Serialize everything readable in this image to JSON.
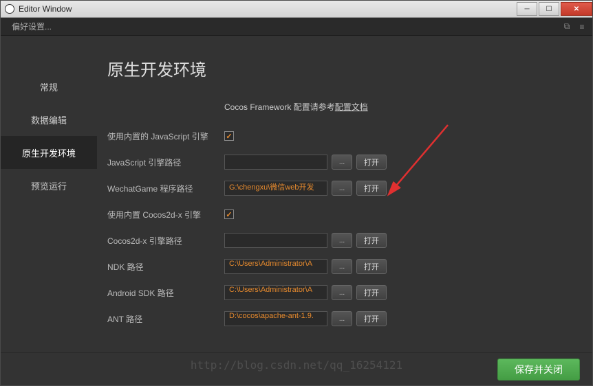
{
  "window": {
    "title": "Editor Window"
  },
  "tabbar": {
    "label": "偏好设置..."
  },
  "sidebar": {
    "items": [
      {
        "label": "常规"
      },
      {
        "label": "数据编辑"
      },
      {
        "label": "原生开发环境"
      },
      {
        "label": "预览运行"
      }
    ]
  },
  "main": {
    "title": "原生开发环境",
    "config_prefix": "Cocos Framework 配置请参考",
    "config_link": "配置文档",
    "rows": {
      "use_builtin_js": {
        "label": "使用内置的 JavaScript 引擎",
        "checked": true
      },
      "js_engine_path": {
        "label": "JavaScript 引擎路径",
        "value": "",
        "open": "打开"
      },
      "wechat_path": {
        "label": "WechatGame 程序路径",
        "value": "G:\\chengxu\\微信web开发",
        "open": "打开"
      },
      "use_builtin_cocos": {
        "label": "使用内置 Cocos2d-x 引擎",
        "checked": true
      },
      "cocos_path": {
        "label": "Cocos2d-x 引擎路径",
        "value": "",
        "open": "打开"
      },
      "ndk_path": {
        "label": "NDK 路径",
        "value": "C:\\Users\\Administrator\\A",
        "open": "打开"
      },
      "sdk_path": {
        "label": "Android SDK 路径",
        "value": "C:\\Users\\Administrator\\A",
        "open": "打开"
      },
      "ant_path": {
        "label": "ANT 路径",
        "value": "D:\\cocos\\apache-ant-1.9.",
        "open": "打开"
      }
    },
    "browse": "..."
  },
  "footer": {
    "save": "保存并关闭"
  },
  "watermark": "http://blog.csdn.net/qq_16254121"
}
